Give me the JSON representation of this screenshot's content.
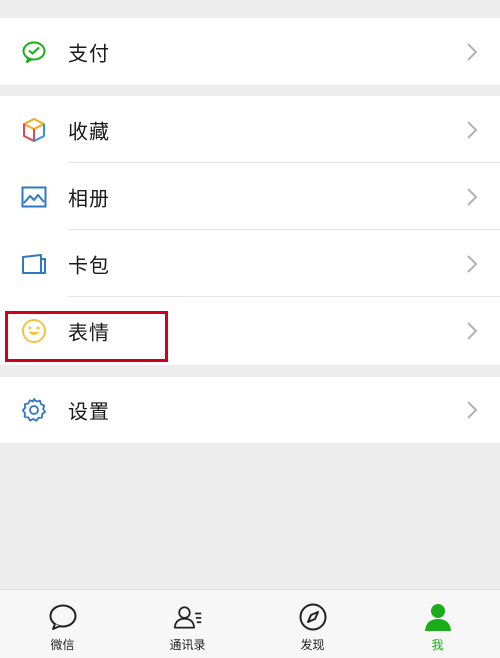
{
  "menu": {
    "group1": [
      {
        "label": "支付",
        "icon": "wechat-pay-icon"
      }
    ],
    "group2": [
      {
        "label": "收藏",
        "icon": "favorites-cube-icon"
      },
      {
        "label": "相册",
        "icon": "album-picture-icon"
      },
      {
        "label": "卡包",
        "icon": "card-wallet-icon"
      },
      {
        "label": "表情",
        "icon": "sticker-smile-icon",
        "highlighted": true
      }
    ],
    "group3": [
      {
        "label": "设置",
        "icon": "settings-gear-icon"
      }
    ]
  },
  "tabbar": {
    "tabs": [
      {
        "label": "微信",
        "icon": "chat-bubble-icon"
      },
      {
        "label": "通讯录",
        "icon": "contacts-icon"
      },
      {
        "label": "发现",
        "icon": "compass-icon"
      },
      {
        "label": "我",
        "icon": "me-person-icon",
        "active": true
      }
    ]
  },
  "colors": {
    "accent": "#1aad19",
    "highlight": "#d0021b",
    "background": "#ededed"
  }
}
